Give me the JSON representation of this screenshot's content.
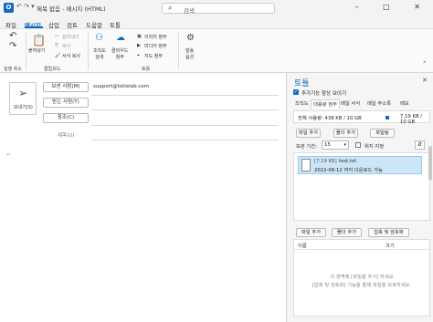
{
  "titlebar": {
    "logo": "O",
    "quick_icons": "↶ ↷ ▾",
    "title": "제목 없음 - 메시지 (HTML)",
    "search_placeholder": "검색",
    "window_controls": "– □ ✕"
  },
  "menu": {
    "tabs": [
      "파일",
      "메시지",
      "삽입",
      "검토",
      "도움말",
      "토틀"
    ],
    "active_tab": "메시지"
  },
  "ribbon": {
    "undo_group": "실행 취소",
    "paste": "붙여넣기",
    "cut": "잘라내기",
    "copy": "복사",
    "format_painter": "서식 복사",
    "clipboard_group": "클립보드",
    "org_search": "조직도\n검색",
    "cloud_attach": "클라우드\n첨부",
    "image_attach": "이미지 첨부",
    "media_attach": "미디어 첨부",
    "map_attach": "지도 첨부",
    "totle_group": "토틀",
    "send_options": "발송\n옵션"
  },
  "compose": {
    "send_label": "보내기(S)",
    "from_button": "보낸 사람(M)",
    "from_value": "support@totlelab.com",
    "to_button": "받는 사람(T)",
    "cc_button": "참조(C)",
    "subject_label": "제목(U)",
    "body_mark": "↵"
  },
  "pane": {
    "title": "토틀",
    "always_show": "추가기능 항상 보이기",
    "tabs": [
      "조직도",
      "대용량 첨부",
      "메일 서식",
      "메일 주소록",
      "메모"
    ],
    "active_tab": "대용량 첨부",
    "usage_text": "전체 사용량: 438 KB / 10 GB",
    "usage_right": "7.19 KB / 10 GB",
    "add_file": "파일 추가",
    "add_folder": "폴더 추가",
    "file_link": "파일링",
    "period_label": "보관 기간:",
    "period_value": "15",
    "password_label": "위지 지정",
    "sort_icon": "⇵",
    "files": [
      {
        "size": "[7.19 KB]",
        "name": "test.txt",
        "expire": "2022-08-12 까지 다운로드 가능"
      }
    ],
    "pc_add_file": "파일 추가",
    "pc_add_folder": "폴더 추가",
    "compress": "압축 및 암호화",
    "pc_col_name": "이름",
    "pc_col_size": "크기",
    "pc_hint1": "이 영역에 [파일을 추가] 하세요",
    "pc_hint2": "[압축 및 암호화] 기능을 통해 파일을 보호하세요."
  }
}
